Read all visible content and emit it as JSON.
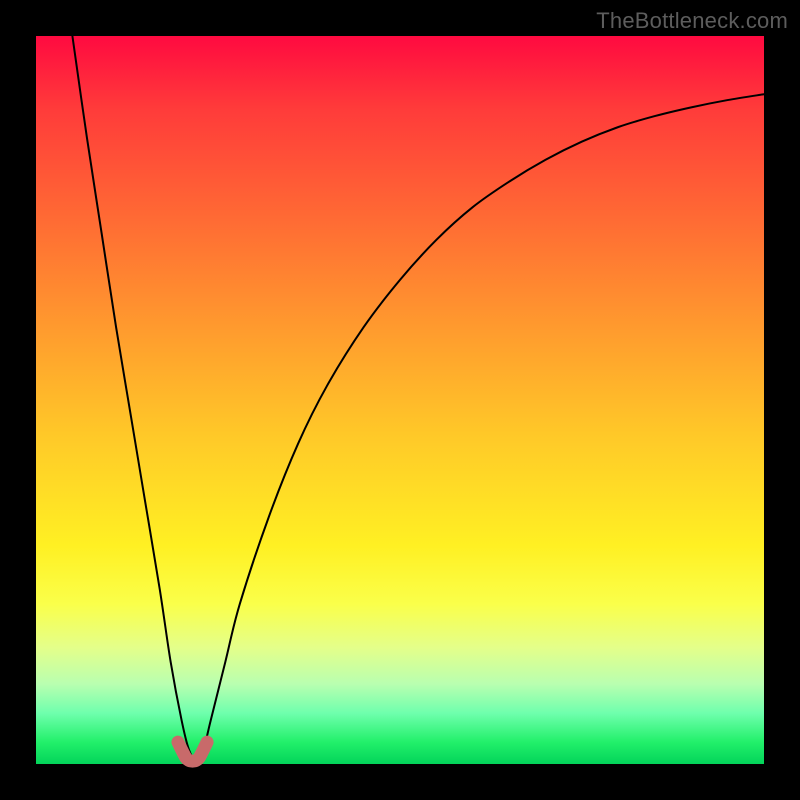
{
  "watermark": "TheBottleneck.com",
  "chart_data": {
    "type": "line",
    "title": "",
    "xlabel": "",
    "ylabel": "",
    "xlim": [
      0,
      100
    ],
    "ylim": [
      0,
      100
    ],
    "background_gradient": {
      "top_color": "#ff0a40",
      "bottom_color": "#03d45a",
      "meaning": "top=red=high bottleneck, bottom=green=low bottleneck"
    },
    "series": [
      {
        "name": "bottleneck-curve",
        "color": "#000000",
        "x": [
          5,
          7,
          9,
          11,
          13,
          15,
          17,
          18.5,
          20,
          21,
          22,
          23,
          24,
          26,
          28,
          32,
          36,
          40,
          45,
          50,
          55,
          60,
          65,
          70,
          75,
          80,
          85,
          90,
          95,
          100
        ],
        "values": [
          100,
          86,
          73,
          60,
          48,
          36,
          24,
          14,
          6,
          2,
          0.5,
          2,
          6,
          14,
          22,
          34,
          44,
          52,
          60,
          66.5,
          72,
          76.5,
          80,
          83,
          85.5,
          87.5,
          89,
          90.2,
          91.2,
          92
        ]
      },
      {
        "name": "valley-marker",
        "color": "#c86a6a",
        "x": [
          19.5,
          20.5,
          21.0,
          21.5,
          22.0,
          22.5,
          23.5
        ],
        "values": [
          3.0,
          1.0,
          0.5,
          0.4,
          0.5,
          1.0,
          3.0
        ]
      }
    ],
    "valley_x": 21.5,
    "valley_y": 0.4
  }
}
